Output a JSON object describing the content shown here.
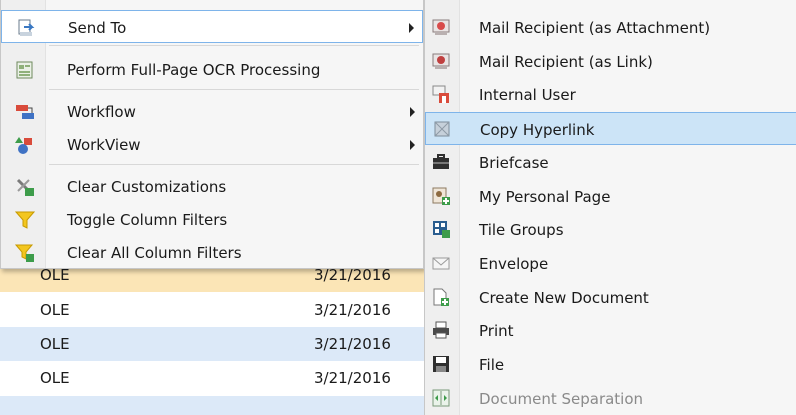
{
  "grid": {
    "rows": [
      {
        "col1": "OLE",
        "col2": "3/21/2016"
      },
      {
        "col1": "OLE",
        "col2": "3/21/2016"
      },
      {
        "col1": "OLE",
        "col2": "3/21/2016"
      },
      {
        "col1": "OLE",
        "col2": "3/21/2016"
      }
    ]
  },
  "context_menu": {
    "items": [
      {
        "label": "Send To",
        "icon": "send-to-icon",
        "has_submenu": true
      },
      {
        "label": "Perform Full-Page OCR Processing",
        "icon": "ocr-icon",
        "has_submenu": false
      },
      {
        "label": "Workflow",
        "icon": "workflow-icon",
        "has_submenu": true
      },
      {
        "label": "WorkView",
        "icon": "workview-icon",
        "has_submenu": true
      },
      {
        "label": "Clear Customizations",
        "icon": "clear-customizations-icon",
        "has_submenu": false
      },
      {
        "label": "Toggle Column Filters",
        "icon": "filter-icon",
        "has_submenu": false
      },
      {
        "label": "Clear All Column Filters",
        "icon": "clear-filter-icon",
        "has_submenu": false
      }
    ]
  },
  "send_to_submenu": {
    "items": [
      {
        "label": "Mail Recipient (as Attachment)",
        "icon": "mail-attachment-icon"
      },
      {
        "label": "Mail Recipient (as Link)",
        "icon": "mail-link-icon"
      },
      {
        "label": "Internal User",
        "icon": "internal-user-icon"
      },
      {
        "label": "Copy Hyperlink",
        "icon": "hyperlink-icon"
      },
      {
        "label": "Briefcase",
        "icon": "briefcase-icon"
      },
      {
        "label": "My Personal Page",
        "icon": "personal-page-icon"
      },
      {
        "label": "Tile Groups",
        "icon": "tile-groups-icon"
      },
      {
        "label": "Envelope",
        "icon": "envelope-icon"
      },
      {
        "label": "Create New Document",
        "icon": "new-document-icon"
      },
      {
        "label": "Print",
        "icon": "print-icon"
      },
      {
        "label": "File",
        "icon": "file-save-icon"
      },
      {
        "label": "Document Separation",
        "icon": "document-separation-icon"
      }
    ]
  },
  "colors": {
    "grid_row_highlight": "#fbe5b6",
    "grid_row_alt": "#dce9f8",
    "submenu_selected": "#cce4f7",
    "selection_border": "#7eb4ea"
  }
}
